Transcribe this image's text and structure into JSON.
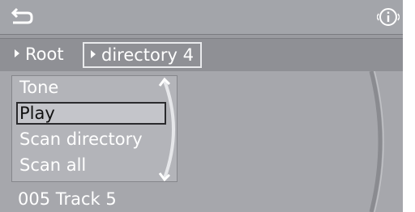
{
  "header": {
    "back_icon": "back-arrow-icon",
    "info_icon": "info-circle-icon"
  },
  "breadcrumb": {
    "items": [
      {
        "label": "Root"
      },
      {
        "label": "directory 4"
      }
    ]
  },
  "menu": {
    "items": [
      {
        "label": "Tone"
      },
      {
        "label": "Play",
        "selected": true
      },
      {
        "label": "Scan directory"
      },
      {
        "label": "Scan all"
      }
    ]
  },
  "status": {
    "track": "005 Track 5"
  },
  "colors": {
    "screen_bg": "#9a9ba0",
    "text": "#ffffff",
    "selected_text": "#111111"
  }
}
